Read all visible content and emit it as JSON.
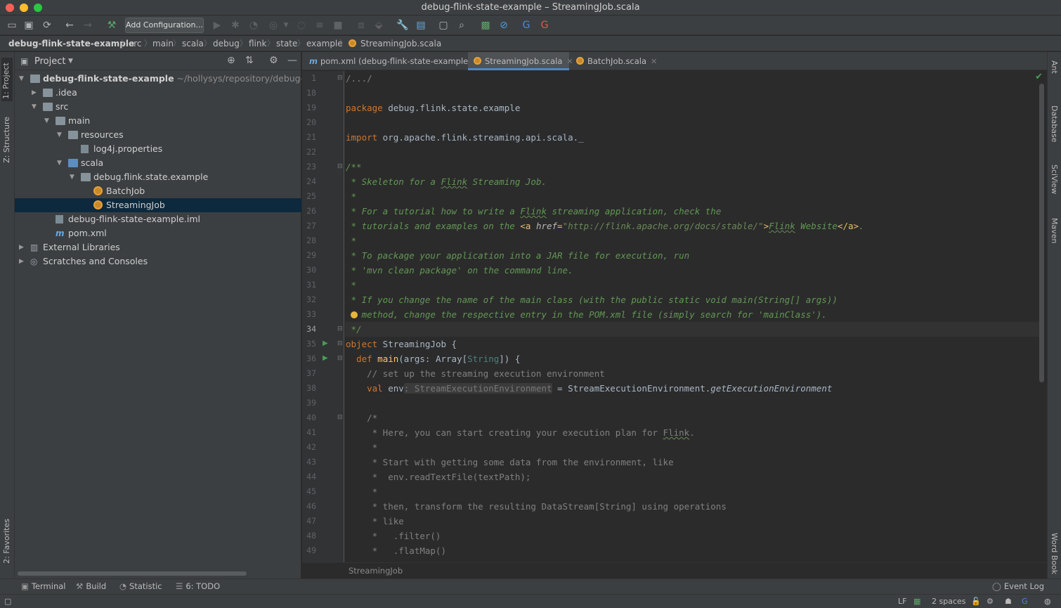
{
  "window": {
    "title": "debug-flink-state-example – StreamingJob.scala"
  },
  "toolbar": {
    "add_config_label": "Add Configuration..."
  },
  "breadcrumb": [
    "debug-flink-state-example",
    "src",
    "main",
    "scala",
    "debug",
    "flink",
    "state",
    "example",
    "StreamingJob.scala"
  ],
  "left_strip": {
    "project_tab": "1: Project",
    "structure_tab": "Z: Structure",
    "favorites_tab": "2: Favorites"
  },
  "right_strip": {
    "ant_tab": "Ant",
    "database_tab": "Database",
    "sciview_tab": "SciView",
    "maven_tab": "Maven",
    "wordbook_tab": "Word Book"
  },
  "project": {
    "title": "Project",
    "tree": [
      {
        "label": "debug-flink-state-example",
        "path": "~/hollysys/repository/debug-flink-",
        "depth": 0,
        "expanded": true,
        "icon": "folder-icon",
        "bold": true
      },
      {
        "label": ".idea",
        "depth": 1,
        "expanded": false,
        "icon": "folder-icon"
      },
      {
        "label": "src",
        "depth": 1,
        "expanded": true,
        "icon": "folder-icon"
      },
      {
        "label": "main",
        "depth": 2,
        "expanded": true,
        "icon": "folder-icon"
      },
      {
        "label": "resources",
        "depth": 3,
        "expanded": true,
        "icon": "resources-folder-icon"
      },
      {
        "label": "log4j.properties",
        "depth": 4,
        "icon": "properties-file-icon"
      },
      {
        "label": "scala",
        "depth": 3,
        "expanded": true,
        "icon": "source-folder-icon"
      },
      {
        "label": "debug.flink.state.example",
        "depth": 4,
        "expanded": true,
        "icon": "package-icon"
      },
      {
        "label": "BatchJob",
        "depth": 5,
        "icon": "scala-object-icon"
      },
      {
        "label": "StreamingJob",
        "depth": 5,
        "icon": "scala-object-icon",
        "selected": true
      },
      {
        "label": "debug-flink-state-example.iml",
        "depth": 2,
        "icon": "iml-file-icon"
      },
      {
        "label": "pom.xml",
        "depth": 2,
        "icon": "maven-file-icon"
      },
      {
        "label": "External Libraries",
        "depth": 0,
        "expanded": false,
        "icon": "library-icon"
      },
      {
        "label": "Scratches and Consoles",
        "depth": 0,
        "expanded": false,
        "icon": "scratches-icon"
      }
    ]
  },
  "tabs": [
    {
      "label": "pom.xml (debug-flink-state-example)",
      "icon": "maven-file-icon",
      "active": false
    },
    {
      "label": "StreamingJob.scala",
      "icon": "scala-object-icon",
      "active": true
    },
    {
      "label": "BatchJob.scala",
      "icon": "scala-object-icon",
      "active": false
    }
  ],
  "editor": {
    "current_line": "34",
    "lines": [
      {
        "n": "1",
        "html": "<span class=\"cm\">/.../</span>"
      },
      {
        "n": "18",
        "html": ""
      },
      {
        "n": "19",
        "html": "<span class=\"kw\">package</span> debug.flink.state.example"
      },
      {
        "n": "20",
        "html": ""
      },
      {
        "n": "21",
        "html": "<span class=\"kw\">import</span> org.apache.flink.streaming.api.scala._"
      },
      {
        "n": "22",
        "html": ""
      },
      {
        "n": "23",
        "html": "<span class=\"doc\">/**</span>"
      },
      {
        "n": "24",
        "html": "<span class=\"doc\"> * Skeleton for a <span class=\"squig\">Flink</span> Streaming Job.</span>"
      },
      {
        "n": "25",
        "html": "<span class=\"doc\"> *</span>"
      },
      {
        "n": "26",
        "html": "<span class=\"doc\"> * For a tutorial how to write a <span class=\"squig\">Flink</span> streaming application, check the</span>"
      },
      {
        "n": "27",
        "html": "<span class=\"doc\"> * tutorials and examples on the <span class=\"tag\">&lt;a </span><span class=\"attr\">href</span><span class=\"tag\">=</span><span class=\"str\">\"http://flink.apache.org/docs/stable/\"</span><span class=\"tag\">&gt;</span><span class=\"squig\">Flink</span> Website<span class=\"tag\">&lt;/a&gt;</span>.</span>"
      },
      {
        "n": "28",
        "html": "<span class=\"doc\"> *</span>"
      },
      {
        "n": "29",
        "html": "<span class=\"doc\"> * To package your application into a JAR file for execution, run</span>"
      },
      {
        "n": "30",
        "html": "<span class=\"doc\"> * 'mvn clean package' on the command line.</span>"
      },
      {
        "n": "31",
        "html": "<span class=\"doc\"> *</span>"
      },
      {
        "n": "32",
        "html": "<span class=\"doc\"> * If you change the name of the main class (with the public static void main(String[] args))</span>"
      },
      {
        "n": "33",
        "html": "<span class=\"doc\">   method, change the respective entry in the POM.xml file (simply search for 'mainClass').</span>"
      },
      {
        "n": "34",
        "html": "<span class=\"doc\"> */</span>"
      },
      {
        "n": "35",
        "html": "<span class=\"kw\">object</span> StreamingJob {"
      },
      {
        "n": "36",
        "html": "  <span class=\"kw\">def</span> <span class=\"fn\">main</span>(args: Array[<span class=\"ty\">String</span>]) {"
      },
      {
        "n": "37",
        "html": "    <span class=\"cm\">// set up the streaming execution environment</span>"
      },
      {
        "n": "38",
        "html": "    <span class=\"kw\">val</span> env<span class=\"hint\">: StreamExecutionEnvironment</span> = StreamExecutionEnvironment.<span class=\"it\">getExecutionEnvironment</span>"
      },
      {
        "n": "39",
        "html": ""
      },
      {
        "n": "40",
        "html": "    <span class=\"cm\">/*</span>"
      },
      {
        "n": "41",
        "html": "<span class=\"cm\">     * Here, you can start creating your execution plan for <span class=\"squig\">Flink</span>.</span>"
      },
      {
        "n": "42",
        "html": "<span class=\"cm\">     *</span>"
      },
      {
        "n": "43",
        "html": "<span class=\"cm\">     * Start with getting some data from the environment, like</span>"
      },
      {
        "n": "44",
        "html": "<span class=\"cm\">     *  env.readTextFile(textPath);</span>"
      },
      {
        "n": "45",
        "html": "<span class=\"cm\">     *</span>"
      },
      {
        "n": "46",
        "html": "<span class=\"cm\">     * then, transform the resulting DataStream[String] using operations</span>"
      },
      {
        "n": "47",
        "html": "<span class=\"cm\">     * like</span>"
      },
      {
        "n": "48",
        "html": "<span class=\"cm\">     *   .filter()</span>"
      },
      {
        "n": "49",
        "html": "<span class=\"cm\">     *   .flatMap()</span>"
      }
    ]
  },
  "editor_footer": {
    "crumb": "StreamingJob"
  },
  "bottom_bar": {
    "terminal": "Terminal",
    "build": "Build",
    "statistic": "Statistic",
    "todo": "6: TODO",
    "event_log": "Event Log"
  },
  "status_bar": {
    "line_sep": "LF",
    "indent": "2 spaces"
  },
  "colors": {
    "accent": "#4a88c7",
    "selection": "#0d293e",
    "keyword": "#cc7832",
    "doc_comment": "#629755"
  }
}
